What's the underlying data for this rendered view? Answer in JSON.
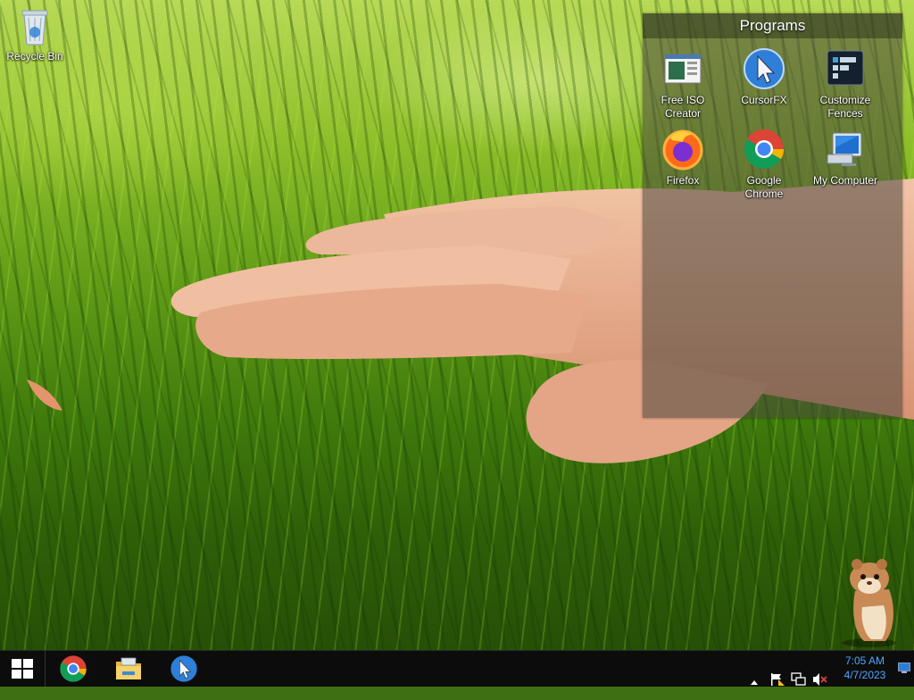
{
  "desktop": {
    "icons": [
      {
        "label": "Recycle Bin",
        "icon": "recycle-bin-icon"
      }
    ]
  },
  "fence": {
    "title": "Programs",
    "items": [
      {
        "label": "Free ISO Creator",
        "line1": "Free ISO",
        "line2": "Creator",
        "icon": "free-iso-creator-icon"
      },
      {
        "label": "CursorFX",
        "line1": "CursorFX",
        "line2": "",
        "icon": "cursorfx-icon"
      },
      {
        "label": "Customize Fences",
        "line1": "Customize",
        "line2": "Fences",
        "icon": "fences-icon"
      },
      {
        "label": "Firefox",
        "line1": "Firefox",
        "line2": "",
        "icon": "firefox-icon"
      },
      {
        "label": "Google Chrome",
        "line1": "Google",
        "line2": "Chrome",
        "icon": "chrome-icon"
      },
      {
        "label": "My Computer",
        "line1": "My Computer",
        "line2": "",
        "icon": "computer-icon"
      }
    ]
  },
  "taskbar": {
    "pinned": [
      "chrome-icon",
      "file-explorer-icon",
      "cursorfx-icon"
    ],
    "tray_icons": [
      "chevron-up-icon",
      "action-center-flag-icon",
      "network-icon",
      "volume-muted-icon"
    ],
    "clock": {
      "time": "7:05 AM",
      "date": "4/7/2023"
    }
  },
  "colors": {
    "taskbar": "#0c0c0c",
    "clock": "#4fa8ff",
    "fence_bg": "rgba(72,70,60,0.55)"
  }
}
